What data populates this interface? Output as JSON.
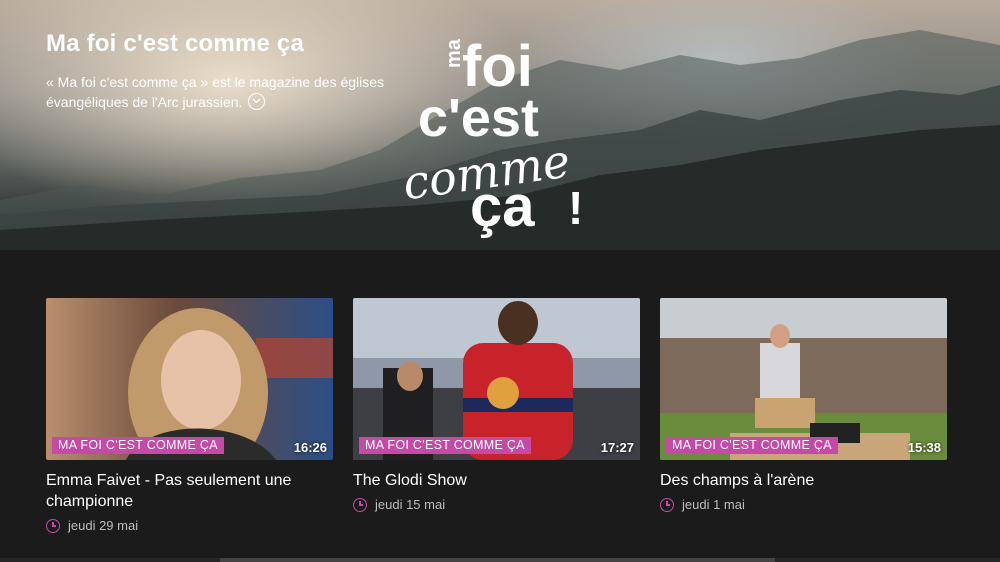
{
  "hero": {
    "title": "Ma foi c'est comme ça",
    "description": "« Ma foi c'est comme ça » est le magazine des églises évangéliques de l'Arc jurassien.",
    "logo_text": [
      "ma",
      "foi",
      "c'est",
      "comme",
      "ça",
      "!"
    ]
  },
  "cards": [
    {
      "badge": "MA FOI C'EST COMME ÇA",
      "duration": "16:26",
      "title": "Emma Faivet - Pas seulement une championne",
      "date": "jeudi 29 mai"
    },
    {
      "badge": "MA FOI C'EST COMME ÇA",
      "duration": "17:27",
      "title": "The Glodi Show",
      "date": "jeudi 15 mai"
    },
    {
      "badge": "MA FOI C'EST COMME ÇA",
      "duration": "15:38",
      "title": "Des champs à l'arène",
      "date": "jeudi 1 mai"
    }
  ],
  "colors": {
    "accent": "#c54aa8",
    "background": "#1b1b1b"
  },
  "icons": {
    "expand": "chevron-down-circle-icon",
    "date": "clock-icon"
  }
}
